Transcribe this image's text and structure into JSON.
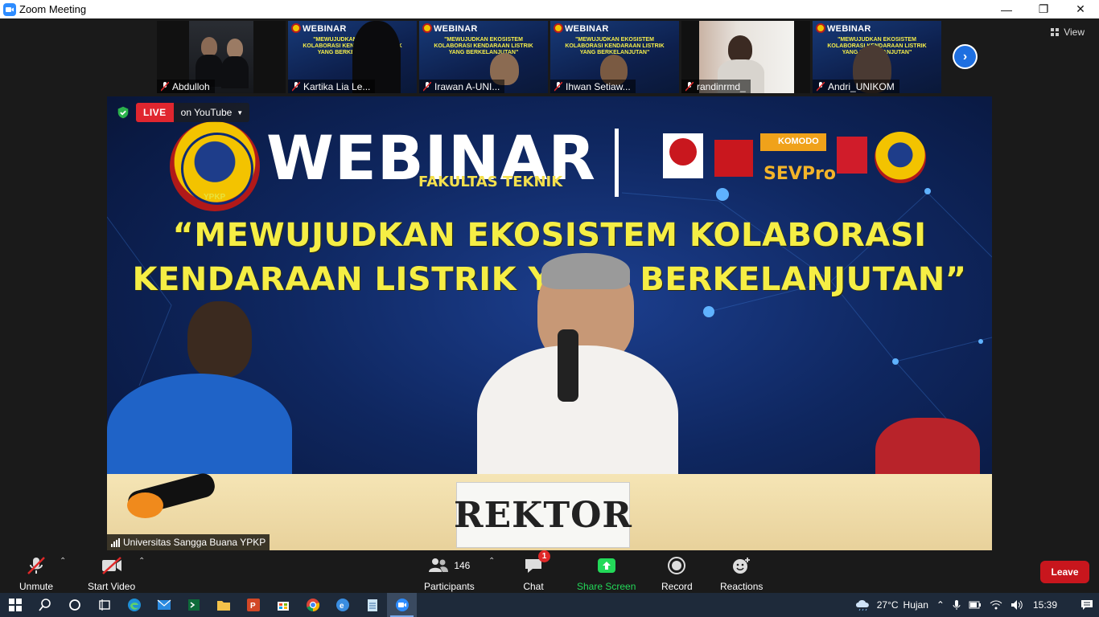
{
  "window": {
    "title": "Zoom Meeting",
    "minimize": "—",
    "restore": "❐",
    "close": "✕"
  },
  "gallery": {
    "view_label": "View",
    "participants": [
      {
        "name": "Abdulloh",
        "kind": "camera"
      },
      {
        "name": "Kartika Lia Le...",
        "kind": "slide"
      },
      {
        "name": "Irawan A-UNI...",
        "kind": "slide"
      },
      {
        "name": "Ihwan Setiaw...",
        "kind": "slide"
      },
      {
        "name": "randinrmd_",
        "kind": "camera"
      },
      {
        "name": "Andri_UNIKOM",
        "kind": "slide"
      }
    ],
    "thumb_slide_title": "WEBINAR",
    "thumb_slide_tagline": "\"MEWUJUDKAN EKOSISTEM KOLABORASI KENDARAAN LISTRIK YANG BERKELANJUTAN\""
  },
  "stage": {
    "live_label": "LIVE",
    "live_platform": "on YouTube",
    "banner_title": "WEBINAR",
    "banner_subtitle": "FAKULTAS TEKNIK",
    "tagline_line1": "“MEWUJUDKAN EKOSISTEM KOLABORASI",
    "tagline_line2": "KENDARAAN LISTRIK YANG BERKELANJUTAN”",
    "sponsor_text": "SEVPro",
    "sponsor_small": "KOMODO",
    "seal_text": "YPKP",
    "placard": "REKTOR",
    "speaker_name": "Universitas Sangga Buana YPKP"
  },
  "toolbar": {
    "unmute": "Unmute",
    "start_video": "Start Video",
    "participants": "Participants",
    "participants_count": "146",
    "chat": "Chat",
    "chat_badge": "1",
    "share_screen": "Share Screen",
    "record": "Record",
    "reactions": "Reactions",
    "leave": "Leave"
  },
  "taskbar": {
    "temperature": "27°C",
    "weather": "Hujan",
    "time": "15:39"
  },
  "colors": {
    "share_green": "#23d959",
    "leave_red": "#c8161d",
    "live_red": "#e0262f",
    "tagline_yellow": "#f5ee45"
  }
}
